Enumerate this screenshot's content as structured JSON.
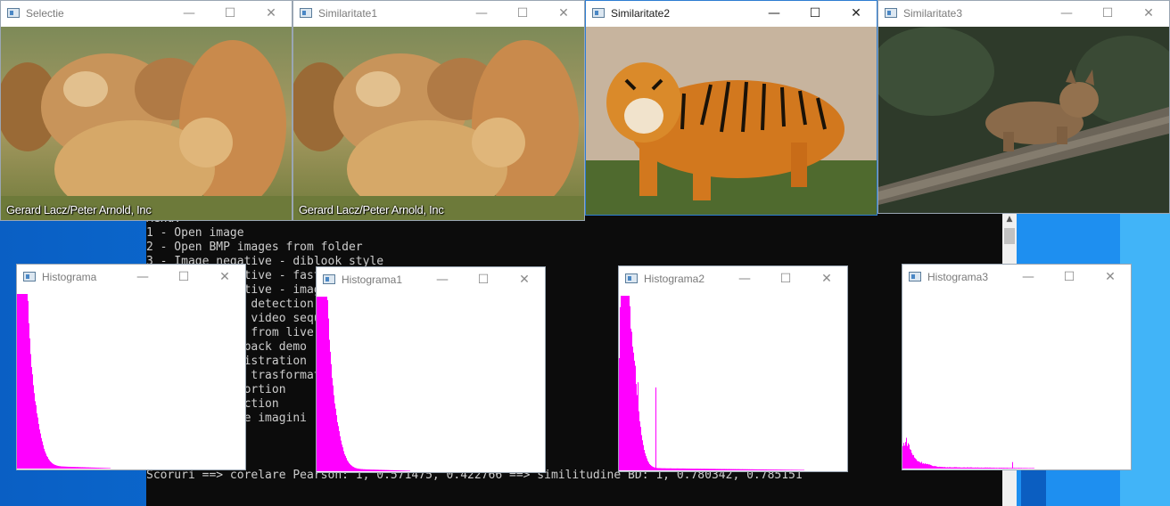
{
  "console": {
    "lines": [
      "Menu:",
      "1 - Open image",
      "2 - Open BMP images from folder",
      "3 - Image negative - diblook style",
      "4 - Image negative - fast",
      "5 - Image negative - image",
      "6 - Canny edge detection",
      "7 - Edges in a video sequence",
      "8 - Snap frame from live video",
      "9 - Mouse callback demo",
      "10 - Image registration",
      "11 - Geometric trasformation",
      "12 - Lens distortion",
      "13 - Reconstruction",
      "14 - Cautare de imagini",
      "",
      "",
      "M = 20",
      "Scoruri ==> corelare Pearson: 1, 0.571475, 0.422766 ==> similitudine BD: 1, 0.780342, 0.785151"
    ]
  },
  "windows": {
    "selectie": {
      "title": "Selectie",
      "credit": "Gerard Lacz/Peter Arnold, Inc"
    },
    "sim1": {
      "title": "Similaritate1",
      "credit": "Gerard Lacz/Peter Arnold, Inc"
    },
    "sim2": {
      "title": "Similaritate2"
    },
    "sim3": {
      "title": "Similaritate3"
    },
    "hist": {
      "title": "Histograma"
    },
    "hist1": {
      "title": "Histograma1"
    },
    "hist2": {
      "title": "Histograma2"
    },
    "hist3": {
      "title": "Histograma3"
    }
  },
  "titlebar_glyphs": {
    "minimize": "—",
    "maximize": "☐",
    "close": "✕"
  },
  "histogram_color": "#ff00ff",
  "histograms": {
    "hist": {
      "peaks": [
        [
          2,
          3,
          0.8
        ],
        [
          4,
          4,
          1.0
        ],
        [
          7,
          5,
          0.55
        ],
        [
          12,
          8,
          0.35
        ],
        [
          18,
          10,
          0.15
        ]
      ],
      "spikes": [],
      "tail": 0.02,
      "tailEnd": 120,
      "noise": 0.05
    },
    "hist1": {
      "peaks": [
        [
          2,
          3,
          0.75
        ],
        [
          4,
          4,
          1.0
        ],
        [
          7,
          5,
          0.6
        ],
        [
          12,
          8,
          0.35
        ],
        [
          18,
          10,
          0.15
        ]
      ],
      "spikes": [],
      "tail": 0.02,
      "tailEnd": 120,
      "noise": 0.05
    },
    "hist2": {
      "peaks": [
        [
          3,
          3,
          0.6
        ],
        [
          6,
          3,
          1.0
        ],
        [
          11,
          6,
          0.5
        ],
        [
          16,
          8,
          0.3
        ]
      ],
      "spikes": [
        [
          18,
          0.6
        ],
        [
          21,
          0.5
        ],
        [
          41,
          0.47
        ],
        [
          5,
          0.4
        ]
      ],
      "tail": 0.015,
      "tailEnd": 250,
      "noise": 0.06
    },
    "hist3": {
      "peaks": [
        [
          2,
          4,
          0.08
        ],
        [
          6,
          5,
          0.06
        ],
        [
          14,
          12,
          0.03
        ]
      ],
      "spikes": [
        [
          123,
          0.03
        ]
      ],
      "tail": 0.01,
      "tailEnd": 200,
      "noise": 0.3
    }
  }
}
